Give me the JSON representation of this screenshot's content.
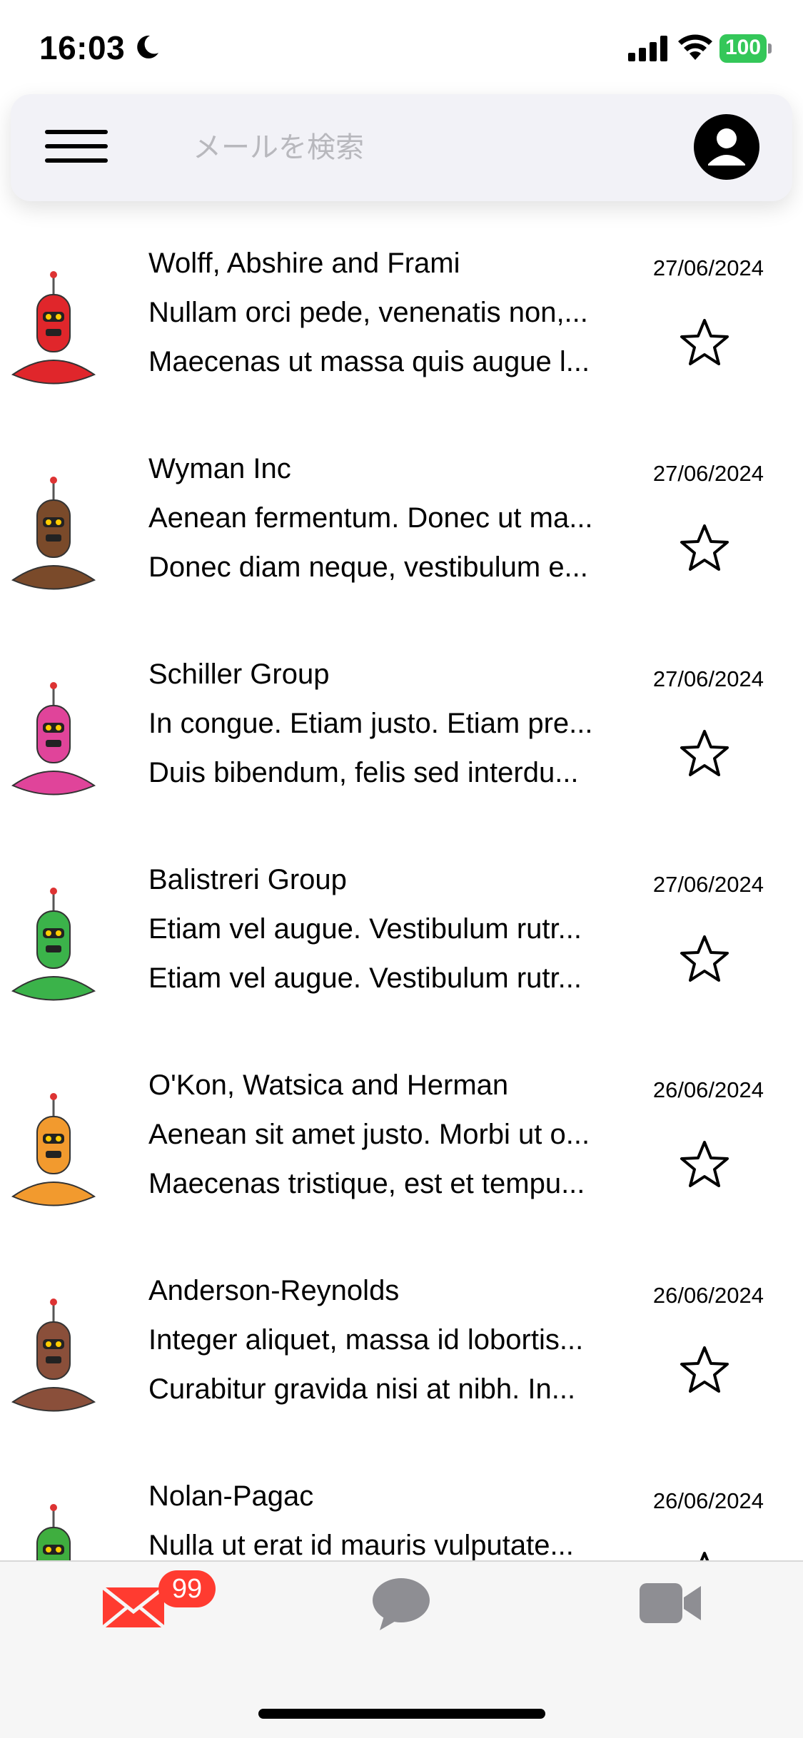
{
  "status_bar": {
    "time": "16:03",
    "battery": "100",
    "icons": [
      "moon-icon",
      "signal-icon",
      "wifi-icon",
      "battery-icon"
    ]
  },
  "search": {
    "placeholder": "メールを検索",
    "value": ""
  },
  "mails": [
    {
      "sender": "Wolff, Abshire and Frami",
      "preview1": "Nullam orci pede, venenatis non,...",
      "preview2": "Maecenas ut massa quis augue l...",
      "date": "27/06/2024",
      "avatar_color": "#e0262b",
      "starred": false
    },
    {
      "sender": "Wyman Inc",
      "preview1": "Aenean fermentum. Donec ut ma...",
      "preview2": "Donec diam neque, vestibulum e...",
      "date": "27/06/2024",
      "avatar_color": "#7a4a2a",
      "starred": false
    },
    {
      "sender": "Schiller Group",
      "preview1": "In congue. Etiam justo. Etiam pre...",
      "preview2": "Duis bibendum, felis sed interdu...",
      "date": "27/06/2024",
      "avatar_color": "#e0449a",
      "starred": false
    },
    {
      "sender": "Balistreri Group",
      "preview1": "Etiam vel augue. Vestibulum rutr...",
      "preview2": "Etiam vel augue. Vestibulum rutr...",
      "date": "27/06/2024",
      "avatar_color": "#3bb34a",
      "starred": false
    },
    {
      "sender": "O'Kon, Watsica and Herman",
      "preview1": "Aenean sit amet justo. Morbi ut o...",
      "preview2": "Maecenas tristique, est et tempu...",
      "date": "26/06/2024",
      "avatar_color": "#f29a2e",
      "starred": false
    },
    {
      "sender": "Anderson-Reynolds",
      "preview1": "Integer aliquet, massa id lobortis...",
      "preview2": "Curabitur gravida nisi at nibh. In...",
      "date": "26/06/2024",
      "avatar_color": "#8a4f3a",
      "starred": false
    },
    {
      "sender": "Nolan-Pagac",
      "preview1": "Nulla ut erat id mauris vulputate...",
      "preview2": "",
      "date": "26/06/2024",
      "avatar_color": "#3fae3f",
      "starred": false
    }
  ],
  "tab_bar": {
    "mail_badge": "99",
    "tabs": [
      "mail-icon",
      "chat-icon",
      "video-icon"
    ],
    "active_color": "#ff3b30",
    "inactive_color": "#8e8e93"
  }
}
